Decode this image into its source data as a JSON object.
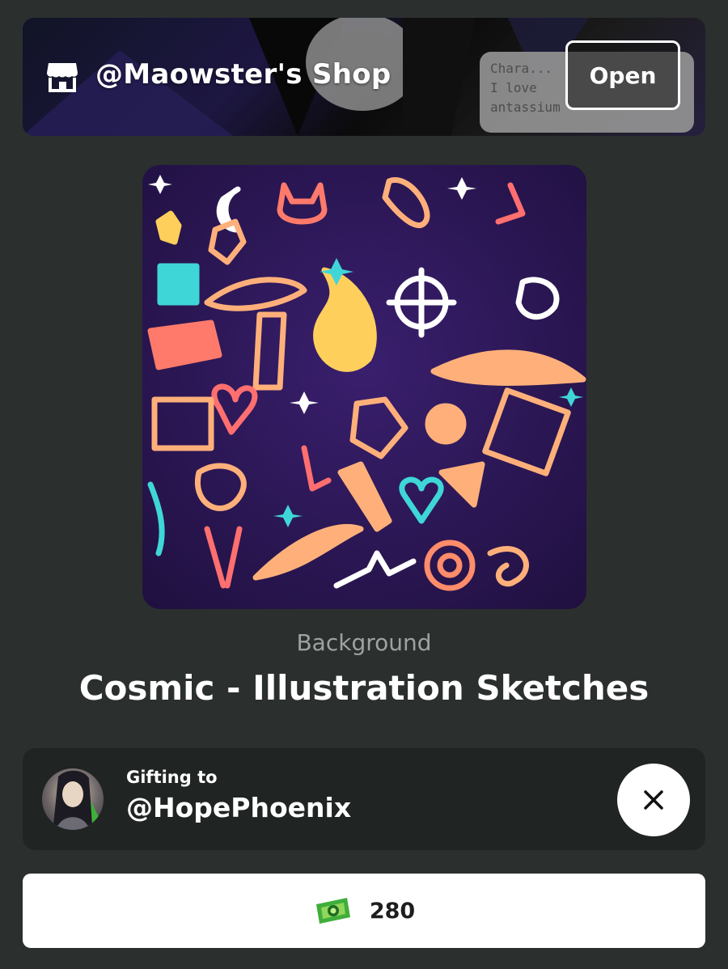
{
  "shop": {
    "name": "@Maowster's Shop",
    "open_label": "Open",
    "banner_bubble_lines": [
      "Chara...",
      "I love",
      "antassium"
    ]
  },
  "item": {
    "type": "Background",
    "title": "Cosmic - Illustration Sketches"
  },
  "gift": {
    "label": "Gifting to",
    "recipient": "@HopePhoenix"
  },
  "purchase": {
    "price": "280",
    "currency_icon": "coins-icon"
  },
  "colors": {
    "background": "#2b2f2e",
    "card": "#202423",
    "accent_cyan": "#3fd6d8",
    "accent_orange": "#ffb07a",
    "accent_pink": "#ff6f6f",
    "coin_green": "#3fae3a"
  }
}
